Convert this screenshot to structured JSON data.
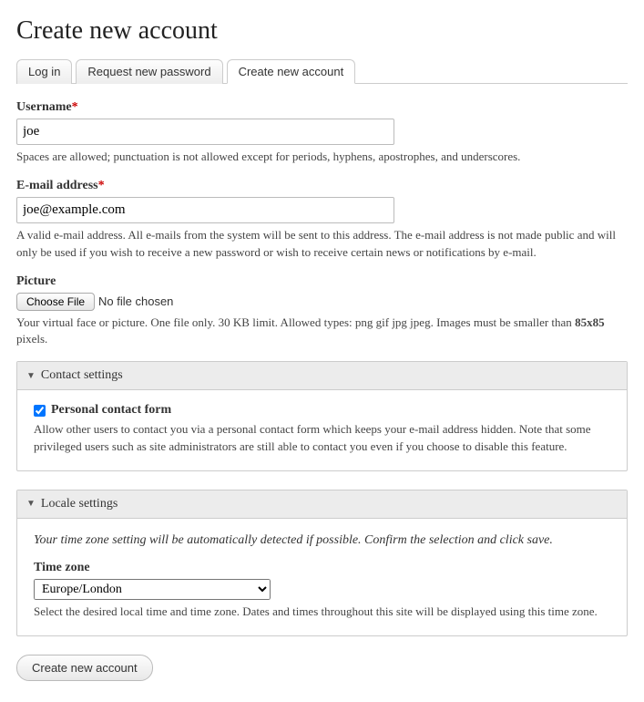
{
  "page_title": "Create new account",
  "tabs": [
    {
      "label": "Log in"
    },
    {
      "label": "Request new password"
    },
    {
      "label": "Create new account"
    }
  ],
  "username": {
    "label": "Username",
    "value": "joe",
    "description": "Spaces are allowed; punctuation is not allowed except for periods, hyphens, apostrophes, and underscores."
  },
  "email": {
    "label": "E-mail address",
    "value": "joe@example.com",
    "description": "A valid e-mail address. All e-mails from the system will be sent to this address. The e-mail address is not made public and will only be used if you wish to receive a new password or wish to receive certain news or notifications by e-mail."
  },
  "picture": {
    "label": "Picture",
    "button_label": "Choose File",
    "status_text": "No file chosen",
    "description_prefix": "Your virtual face or picture. One file only. 30 KB limit. Allowed types: png gif jpg jpeg. Images must be smaller than ",
    "description_bold": "85x85",
    "description_suffix": " pixels."
  },
  "contact": {
    "legend": "Contact settings",
    "checkbox_label": "Personal contact form",
    "checked": true,
    "description": "Allow other users to contact you via a personal contact form which keeps your e-mail address hidden. Note that some privileged users such as site administrators are still able to contact you even if you choose to disable this feature."
  },
  "locale": {
    "legend": "Locale settings",
    "note": "Your time zone setting will be automatically detected if possible. Confirm the selection and click save.",
    "tz_label": "Time zone",
    "tz_value": "Europe/London",
    "tz_description": "Select the desired local time and time zone. Dates and times throughout this site will be displayed using this time zone."
  },
  "submit_label": "Create new account",
  "required_marker": "*"
}
